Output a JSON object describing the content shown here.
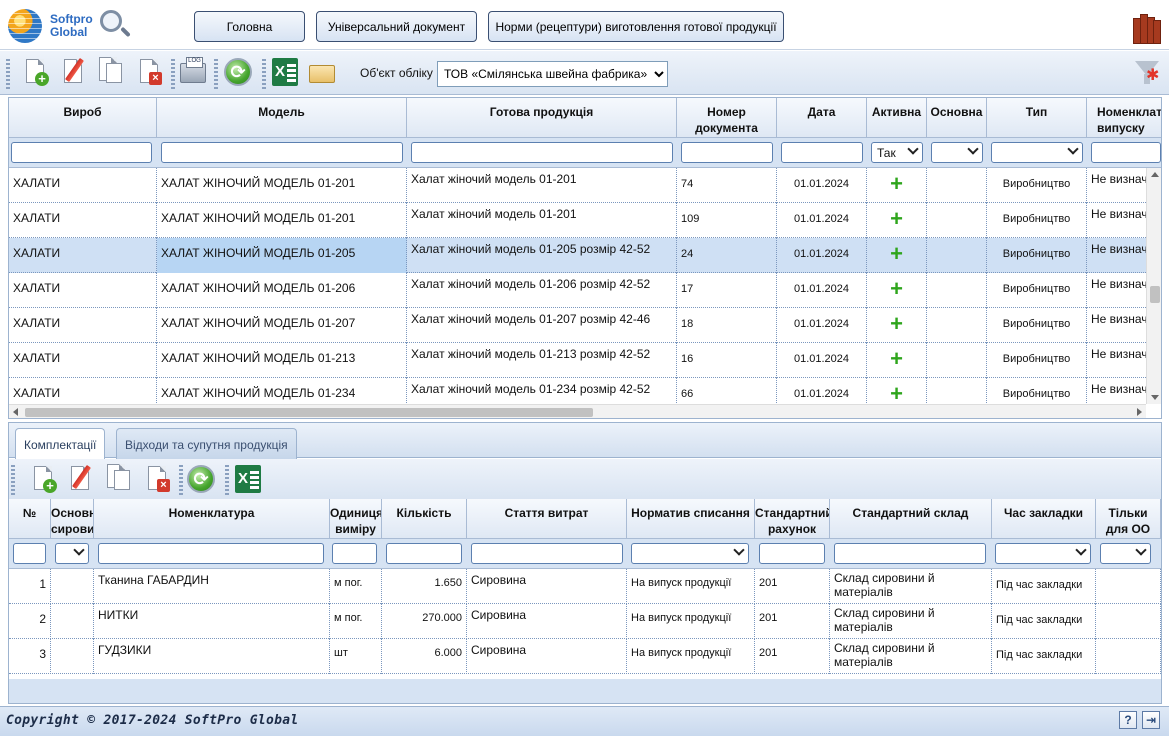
{
  "header": {
    "logo_line1": "Softpro",
    "logo_line2": "Global",
    "nav": [
      "Головна",
      "Універсальний документ",
      "Норми (рецептури) виготовлення готової продукції"
    ]
  },
  "toolbar": {
    "icons": [
      "add-document-icon",
      "edit-icon",
      "copy-icon",
      "delete-icon",
      "log-icon",
      "refresh-icon",
      "excel-icon",
      "key-folder-icon"
    ],
    "object_label": "Об'єкт обліку",
    "object_value": "ТОВ «Смілянська швейна фабрика»"
  },
  "grid1": {
    "headers": [
      "Вироб",
      "Модель",
      "Готова продукція",
      "Номер документа",
      "Дата",
      "Активна",
      "Основна",
      "Тип",
      "Номенклатура випуску"
    ],
    "active_filter": "Так",
    "rows": [
      {
        "vyrob": "ХАЛАТИ",
        "model": "ХАЛАТ ЖІНОЧИЙ МОДЕЛЬ 01-201",
        "product": "Халат жіночий модель 01-201",
        "num": "74",
        "date": "01.01.2024",
        "type": "Виробництво",
        "nom": "Не визначе"
      },
      {
        "vyrob": "ХАЛАТИ",
        "model": "ХАЛАТ ЖІНОЧИЙ МОДЕЛЬ 01-201",
        "product": "Халат жіночий модель 01-201",
        "num": "109",
        "date": "01.01.2024",
        "type": "Виробництво",
        "nom": "Не визначе"
      },
      {
        "vyrob": "ХАЛАТИ",
        "model": "ХАЛАТ ЖІНОЧИЙ МОДЕЛЬ 01-205",
        "product": "Халат жіночий модель 01-205 розмір 42-52",
        "num": "24",
        "date": "01.01.2024",
        "type": "Виробництво",
        "nom": "Не визначе"
      },
      {
        "vyrob": "ХАЛАТИ",
        "model": "ХАЛАТ ЖІНОЧИЙ МОДЕЛЬ 01-206",
        "product": "Халат жіночий модель 01-206 розмір 42-52",
        "num": "17",
        "date": "01.01.2024",
        "type": "Виробництво",
        "nom": "Не визначе"
      },
      {
        "vyrob": "ХАЛАТИ",
        "model": "ХАЛАТ ЖІНОЧИЙ МОДЕЛЬ 01-207",
        "product": "Халат жіночий модель 01-207 розмір 42-46",
        "num": "18",
        "date": "01.01.2024",
        "type": "Виробництво",
        "nom": "Не визначе"
      },
      {
        "vyrob": "ХАЛАТИ",
        "model": "ХАЛАТ ЖІНОЧИЙ МОДЕЛЬ 01-213",
        "product": "Халат жіночий модель 01-213 розмір 42-52",
        "num": "16",
        "date": "01.01.2024",
        "type": "Виробництво",
        "nom": "Не визначе"
      },
      {
        "vyrob": "ХАЛАТИ",
        "model": "ХАЛАТ ЖІНОЧИЙ МОДЕЛЬ 01-234",
        "product": "Халат жіночий модель 01-234 розмір 42-52",
        "num": "66",
        "date": "01.01.2024",
        "type": "Виробництво",
        "nom": "Не визначе"
      }
    ]
  },
  "tabs": [
    "Комплектації",
    "Відходи та супутня продукція"
  ],
  "grid2": {
    "headers": [
      "№",
      "Основна сировина",
      "Номенклатура",
      "Одиниця виміру",
      "Кількість",
      "Стаття витрат",
      "Норматив списання",
      "Стандартний рахунок",
      "Стандартний склад",
      "Час закладки",
      "Тільки для ОО"
    ],
    "rows": [
      {
        "n": "1",
        "nom": "Тканина ГАБАРДИН",
        "unit": "м пог.",
        "qty": "1.650",
        "cost": "Сировина",
        "norm": "На випуск продукції",
        "acc": "201",
        "wh1": "Склад сировини й",
        "wh2": "матеріалів",
        "time": "Під час закладки"
      },
      {
        "n": "2",
        "nom": "НИТКИ",
        "unit": "м пог.",
        "qty": "270.000",
        "cost": "Сировина",
        "norm": "На випуск продукції",
        "acc": "201",
        "wh1": "Склад сировини й",
        "wh2": "матеріалів",
        "time": "Під час закладки"
      },
      {
        "n": "3",
        "nom": "ГУДЗИКИ",
        "unit": "шт",
        "qty": "6.000",
        "cost": "Сировина",
        "norm": "На випуск продукції",
        "acc": "201",
        "wh1": "Склад сировини й",
        "wh2": "матеріалів",
        "time": "Під час закладки"
      }
    ]
  },
  "footer": {
    "copyright": "Copyright © 2017-2024 SoftPro Global",
    "help": "?",
    "exit_icon": "exit-icon"
  }
}
